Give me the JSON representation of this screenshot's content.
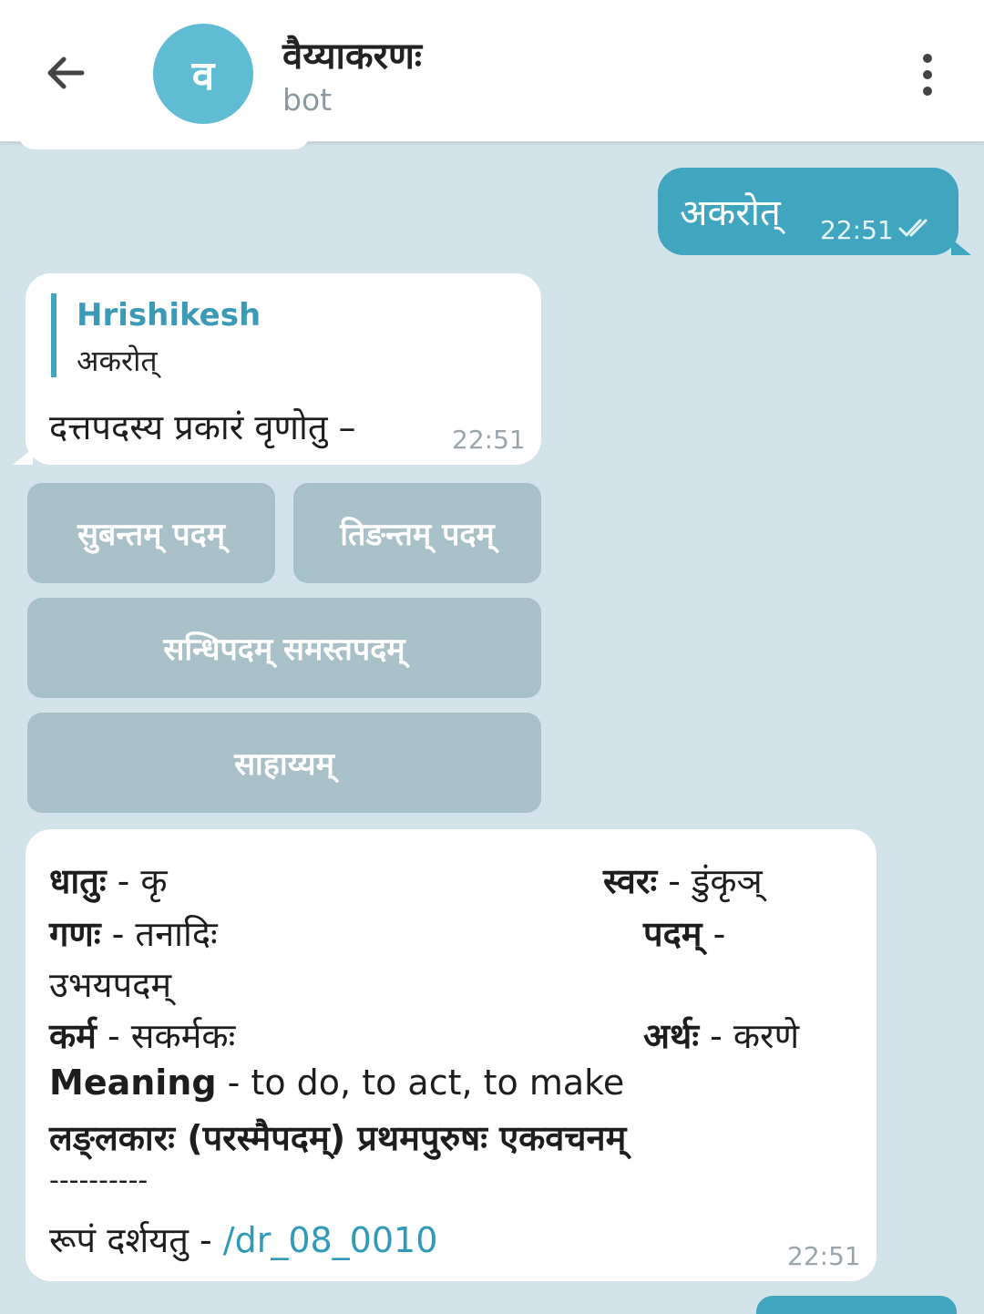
{
  "header": {
    "avatar_letter": "व",
    "title": "वैय्याकरणः",
    "subtitle": "bot"
  },
  "messages": {
    "outgoing": {
      "text": "अकरोत्",
      "time": "22:51"
    },
    "reply": {
      "quote_author": "Hrishikesh",
      "quote_text": "अकरोत्",
      "text": "दत्तपदस्य प्रकारं वृणोतु –",
      "time": "22:51"
    },
    "keyboard": [
      "सुबन्तम् पदम्",
      "तिङन्तम् पदम्",
      "सन्धिपदम् समस्तपदम्",
      "साहाय्यम्"
    ],
    "result": {
      "dhatu_label": "धातुः",
      "dhatu_value": " - कृ",
      "svara_label": "स्वरः",
      "svara_value": " - डुंकृञ्",
      "gana_label": "गणः",
      "gana_value": " - तनादिः",
      "padam_label": "पदम्",
      "padam_value": " -",
      "padam_cont": "उभयपदम्",
      "karma_label": "कर्म",
      "karma_value": " - सकर्मकः",
      "artha_label": "अर्थः",
      "artha_value": " - करणे",
      "meaning_label": "Meaning",
      "meaning_value": " - to do, to act, to make",
      "lakara_line": "लङ्लकारः (परस्मैपदम्) प्रथमपुरुषः एकवचनम्",
      "separator": "----------",
      "show_label": "रूपं दर्शयतु - ",
      "show_link": "/dr_08_0010",
      "time": "22:51"
    }
  },
  "colors": {
    "chat_background": "#d3e3ea",
    "outgoing_bubble": "#40a6c0",
    "avatar": "#5fbcd3",
    "keyboard_button": "#a8c0c8",
    "link": "#2f9ab7"
  },
  "icons": [
    "back-arrow-icon",
    "more-vertical-icon",
    "double-check-icon"
  ]
}
